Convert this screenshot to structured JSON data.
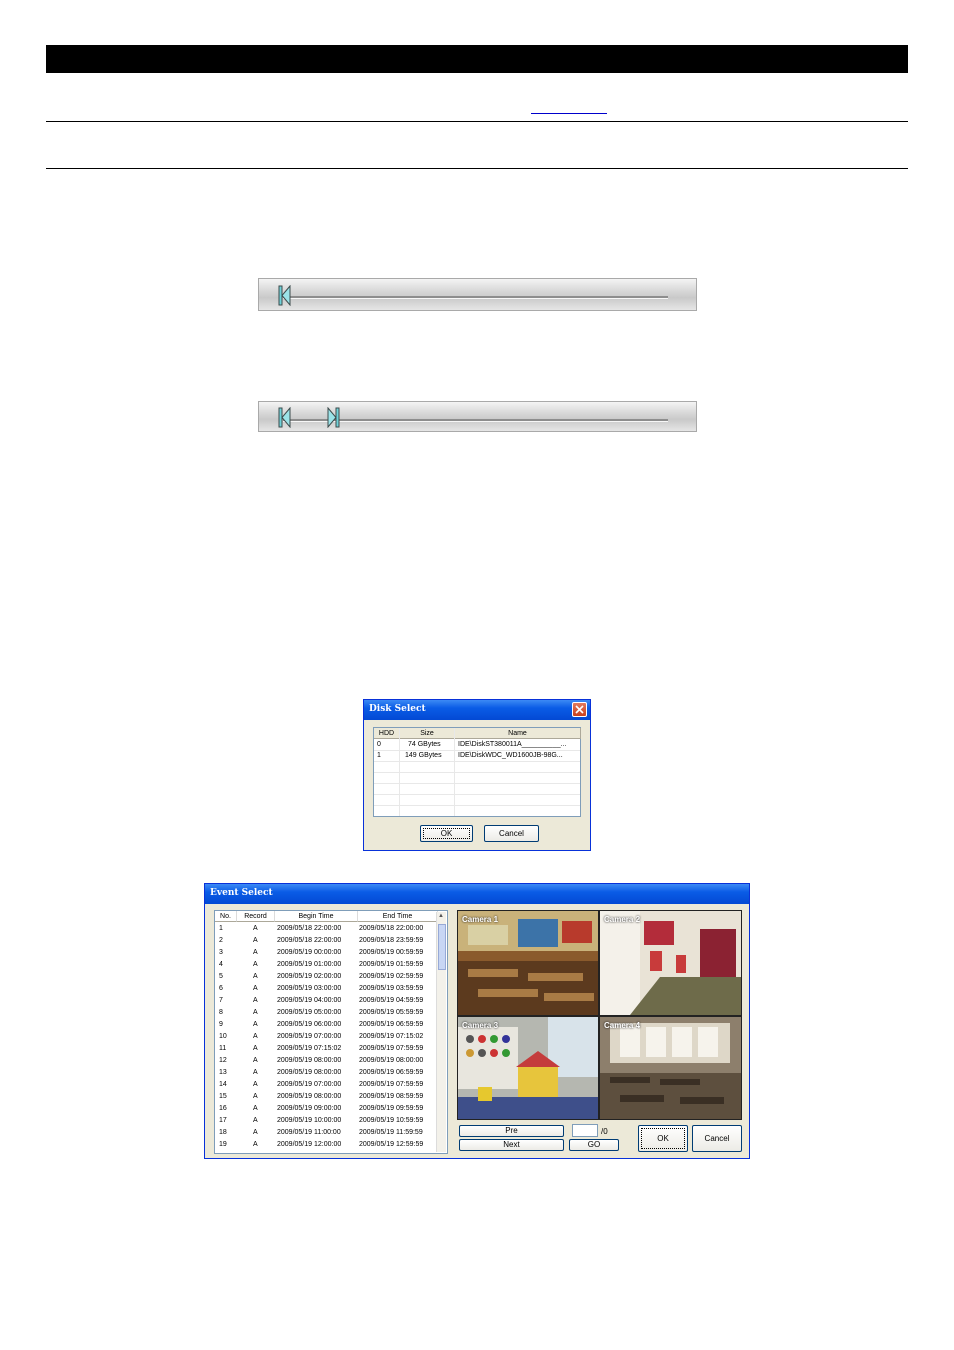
{
  "disk_select": {
    "title": "Disk Select",
    "columns": [
      "HDD",
      "Size",
      "Name"
    ],
    "rows": [
      {
        "hdd": "0",
        "size": "74 GBytes",
        "name": "IDE\\DiskST380011A__________..."
      },
      {
        "hdd": "1",
        "size": "149 GBytes",
        "name": "IDE\\DiskWDC_WD1600JB-98G..."
      }
    ],
    "ok_label": "OK",
    "cancel_label": "Cancel"
  },
  "event_select": {
    "title": "Event Select",
    "columns": [
      "No.",
      "Record",
      "Begin Time",
      "End Time"
    ],
    "rows": [
      {
        "no": "1",
        "record": "A",
        "begin": "2009/05/18 22:00:00",
        "end": "2009/05/18 22:00:00"
      },
      {
        "no": "2",
        "record": "A",
        "begin": "2009/05/18 22:00:00",
        "end": "2009/05/18 23:59:59"
      },
      {
        "no": "3",
        "record": "A",
        "begin": "2009/05/19 00:00:00",
        "end": "2009/05/19 00:59:59"
      },
      {
        "no": "4",
        "record": "A",
        "begin": "2009/05/19 01:00:00",
        "end": "2009/05/19 01:59:59"
      },
      {
        "no": "5",
        "record": "A",
        "begin": "2009/05/19 02:00:00",
        "end": "2009/05/19 02:59:59"
      },
      {
        "no": "6",
        "record": "A",
        "begin": "2009/05/19 03:00:00",
        "end": "2009/05/19 03:59:59"
      },
      {
        "no": "7",
        "record": "A",
        "begin": "2009/05/19 04:00:00",
        "end": "2009/05/19 04:59:59"
      },
      {
        "no": "8",
        "record": "A",
        "begin": "2009/05/19 05:00:00",
        "end": "2009/05/19 05:59:59"
      },
      {
        "no": "9",
        "record": "A",
        "begin": "2009/05/19 06:00:00",
        "end": "2009/05/19 06:59:59"
      },
      {
        "no": "10",
        "record": "A",
        "begin": "2009/05/19 07:00:00",
        "end": "2009/05/19 07:15:02"
      },
      {
        "no": "11",
        "record": "A",
        "begin": "2009/05/19 07:15:02",
        "end": "2009/05/19 07:59:59"
      },
      {
        "no": "12",
        "record": "A",
        "begin": "2009/05/19 08:00:00",
        "end": "2009/05/19 08:00:00"
      },
      {
        "no": "13",
        "record": "A",
        "begin": "2009/05/19 08:00:00",
        "end": "2009/05/19 06:59:59"
      },
      {
        "no": "14",
        "record": "A",
        "begin": "2009/05/19 07:00:00",
        "end": "2009/05/19 07:59:59"
      },
      {
        "no": "15",
        "record": "A",
        "begin": "2009/05/19 08:00:00",
        "end": "2009/05/19 08:59:59"
      },
      {
        "no": "16",
        "record": "A",
        "begin": "2009/05/19 09:00:00",
        "end": "2009/05/19 09:59:59"
      },
      {
        "no": "17",
        "record": "A",
        "begin": "2009/05/19 10:00:00",
        "end": "2009/05/19 10:59:59"
      },
      {
        "no": "18",
        "record": "A",
        "begin": "2009/05/19 11:00:00",
        "end": "2009/05/19 11:59:59"
      },
      {
        "no": "19",
        "record": "A",
        "begin": "2009/05/19 12:00:00",
        "end": "2009/05/19 12:59:59"
      }
    ],
    "cameras": [
      "Camera 1",
      "Camera 2",
      "Camera 3",
      "Camera 4"
    ],
    "pre_label": "Pre",
    "next_label": "Next",
    "page_total": "/0",
    "go_label": "GO",
    "ok_label": "OK",
    "cancel_label": "Cancel"
  }
}
